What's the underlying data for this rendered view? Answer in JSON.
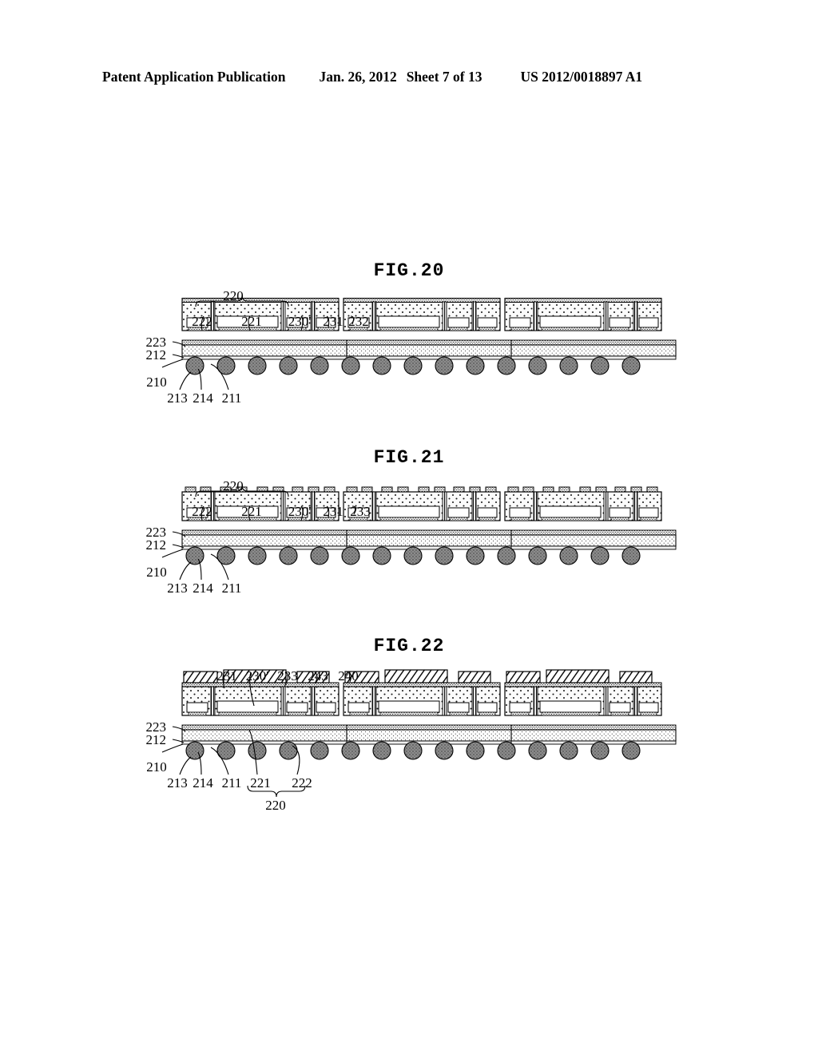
{
  "header": {
    "left": "Patent Application Publication",
    "date": "Jan. 26, 2012",
    "sheet": "Sheet 7 of 13",
    "publication_number": "US 2012/0018897 A1"
  },
  "figures": [
    {
      "id": "fig-20",
      "title": "FIG.20",
      "callouts_top": [
        "220",
        "222",
        "221",
        "230'",
        "231",
        "232"
      ],
      "callouts_left": [
        "223",
        "212",
        "210"
      ],
      "callouts_bottom": [
        "213",
        "214",
        "211"
      ],
      "brace_label": "220",
      "labels": {
        "l220": "220",
        "l222": "222",
        "l221": "221",
        "l230p": "230'",
        "l231": "231",
        "l232": "232",
        "l223": "223",
        "l212": "212",
        "l210": "210",
        "l213": "213",
        "l214": "214",
        "l211": "211"
      }
    },
    {
      "id": "fig-21",
      "title": "FIG.21",
      "callouts_top": [
        "220",
        "222",
        "221",
        "230'",
        "231",
        "233"
      ],
      "callouts_left": [
        "223",
        "212",
        "210"
      ],
      "callouts_bottom": [
        "213",
        "214",
        "211"
      ],
      "brace_label": "220",
      "labels": {
        "l220": "220",
        "l222": "222",
        "l221": "221",
        "l230p": "230'",
        "l231": "231",
        "l233": "233",
        "l223": "223",
        "l212": "212",
        "l210": "210",
        "l213": "213",
        "l214": "214",
        "l211": "211"
      }
    },
    {
      "id": "fig-22",
      "title": "FIG.22",
      "callouts_top": [
        "231",
        "230'",
        "233",
        "243",
        "240"
      ],
      "callouts_left": [
        "223",
        "212",
        "210"
      ],
      "callouts_bottom": [
        "213",
        "214",
        "211",
        "221",
        "222"
      ],
      "brace_label": "220",
      "labels": {
        "l231": "231",
        "l230p": "230'",
        "l233": "233",
        "l243": "243",
        "l240": "240",
        "l223": "223",
        "l212": "212",
        "l210": "210",
        "l213": "213",
        "l214": "214",
        "l211": "211",
        "l221": "221",
        "l222": "222",
        "l220": "220"
      }
    }
  ],
  "style": {
    "line_color": "#000000",
    "solder_ball_fill": "#8c8c8c",
    "encapsulant_fill": "#fbfbfb",
    "substrate_fill": "#fdfdfd",
    "hatch_fill": "#ffffff"
  }
}
